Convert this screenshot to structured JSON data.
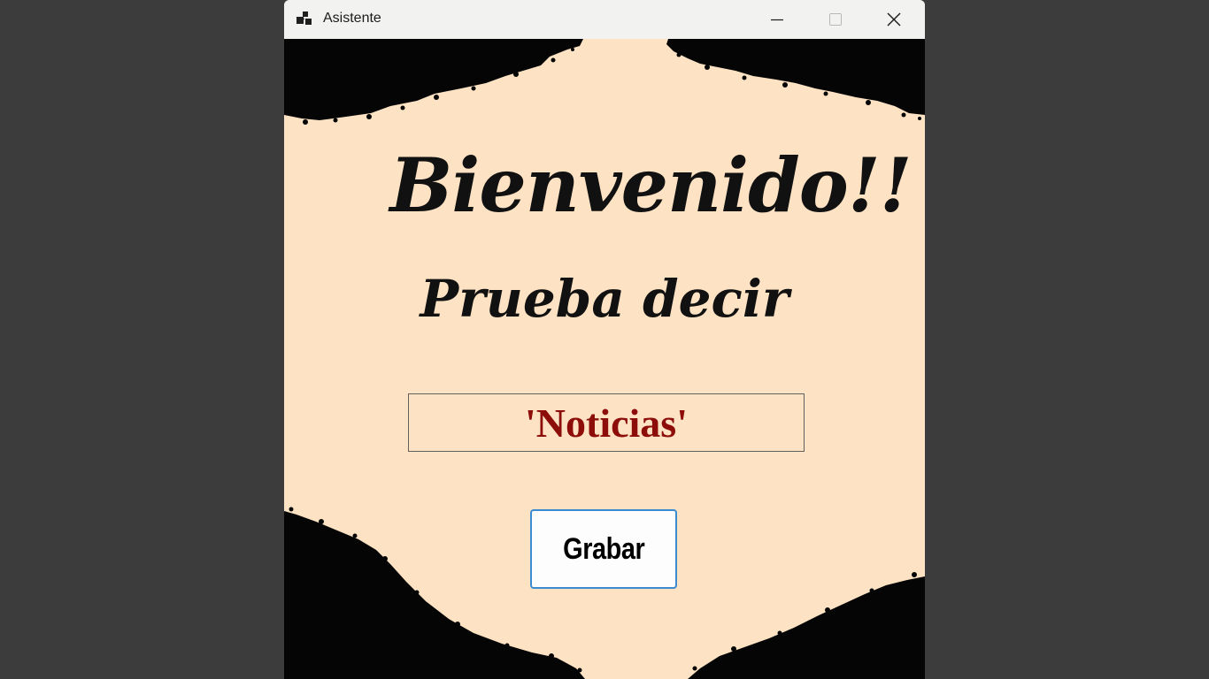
{
  "window": {
    "title": "Asistente",
    "controls": {
      "minimize": "minimize-icon",
      "maximize": "maximize-icon",
      "close": "close-icon"
    }
  },
  "content": {
    "welcome": "Bienvenido!!",
    "subtitle": "Prueba decir",
    "phrase": "'Noticias'",
    "record_button": "Grabar"
  },
  "colors": {
    "background": "#fde3c4",
    "phrase_text": "#8c0d09",
    "button_border": "#3b8bd2",
    "desktop": "#3d3c3c"
  }
}
